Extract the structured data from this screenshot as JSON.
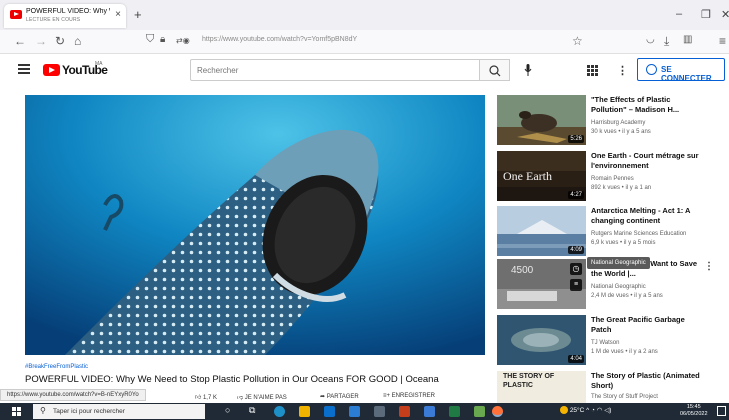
{
  "browser": {
    "tab_title": "POWERFUL VIDEO: Why We Ne",
    "tab_subtitle": "LECTURE EN COURS",
    "url": "https://www.youtube.com/watch?v=Yomf5pBN8dY"
  },
  "youtube": {
    "logo_text": "YouTube",
    "country_code": "MA",
    "search_placeholder": "Rechercher",
    "signin_label": "SE CONNECTER"
  },
  "video": {
    "hashtag": "#BreakFreeFromPlastic",
    "title": "POWERFUL VIDEO: Why We Need to Stop Plastic Pollution in Our Oceans FOR GOOD | Oceana",
    "actions": {
      "likes": "1,7 K",
      "dislike": "JE N'AIME PAS",
      "share": "PARTAGER",
      "save": "ENREGISTRER"
    }
  },
  "status_url": "https://www.youtube.com/watch?v=B-nEYxyR0Yo",
  "recommendations": [
    {
      "title": "\"The Effects of Plastic Pollution\" – Madison H...",
      "channel": "Harrisburg Academy",
      "meta": "30 k vues • il y a 5 ans",
      "duration": "5:26",
      "thumb_text": ""
    },
    {
      "title": "One Earth - Court métrage sur l'environnement",
      "channel": "Romain Pennes",
      "meta": "892 k vues • il y a 1 an",
      "duration": "4:27",
      "thumb_text": "One Earth"
    },
    {
      "title": "Antarctica Melting - Act 1: A changing continent",
      "channel": "Rutgers Marine Sciences Education",
      "meta": "6,9 k vues • il y a 5 mois",
      "duration": "4:09",
      "thumb_text": ""
    },
    {
      "title": "…Will Make You Want to Save the World |...",
      "channel": "National Geographic",
      "meta": "2,4 M de vues • il y a 5 ans",
      "duration": "",
      "thumb_text": "4500"
    },
    {
      "title": "The Great Pacific Garbage Patch",
      "channel": "TJ Watson",
      "meta": "1 M de vues • il y a 2 ans",
      "duration": "4:04",
      "thumb_text": ""
    },
    {
      "title": "The Story of Plastic (Animated Short)",
      "channel": "The Story of Stuff Project",
      "meta": "",
      "duration": "",
      "thumb_text": "THE STORY OF PLASTIC"
    }
  ],
  "tooltip": "National Geographic",
  "taskbar": {
    "search_placeholder": "Taper ici pour rechercher",
    "temperature": "25°C",
    "time": "15:45",
    "date": "06/05/2022"
  },
  "colors": {
    "youtube_red": "#ff0000",
    "link_blue": "#065fd4",
    "taskbar": "#1f2a36"
  }
}
